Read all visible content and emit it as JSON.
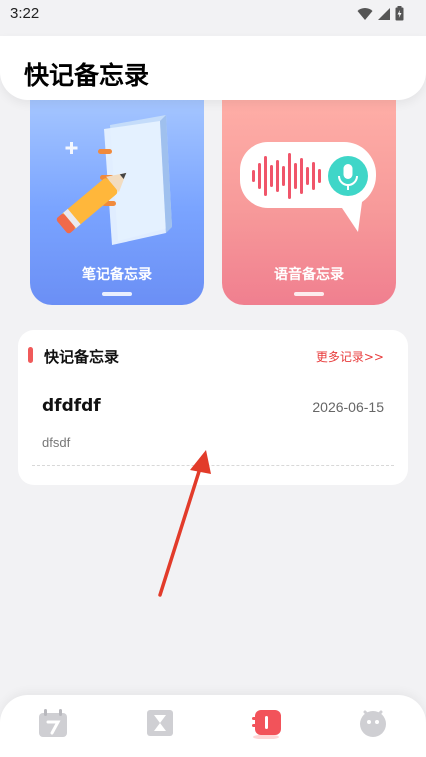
{
  "status_bar": {
    "time": "3:22"
  },
  "header": {
    "title": "快记备忘录"
  },
  "cards": [
    {
      "label": "笔记备忘录",
      "icon": "notebook-pencil-icon",
      "color": "#7aa4ff"
    },
    {
      "label": "语音备忘录",
      "icon": "voice-wave-mic-icon",
      "color": "#f58d95"
    }
  ],
  "records": {
    "title": "快记备忘录",
    "more_link": "更多记录>>",
    "items": [
      {
        "title": "dfdfdf",
        "date": "2026-06-15",
        "body": "dfsdf"
      }
    ]
  },
  "bottom_nav": {
    "items": [
      {
        "icon": "calendar-icon",
        "active": false
      },
      {
        "icon": "hourglass-icon",
        "active": false
      },
      {
        "icon": "notes-icon",
        "active": true
      },
      {
        "icon": "face-icon",
        "active": false
      }
    ]
  },
  "colors": {
    "accent": "#f05a5a",
    "background": "#f2f2f4"
  }
}
